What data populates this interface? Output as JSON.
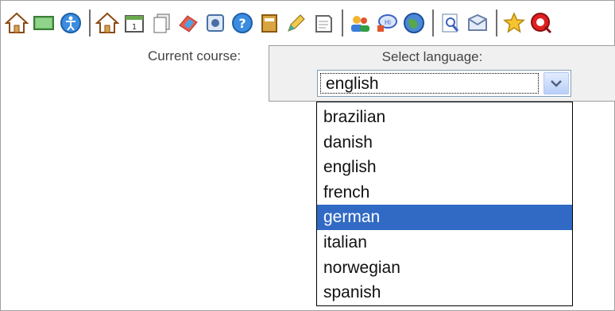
{
  "toolbar": {
    "groups": [
      [
        "home-icon",
        "blackboard-icon",
        "accessibility-icon"
      ],
      [
        "course-home-icon",
        "calendar-icon",
        "documents-icon",
        "lesson-icon",
        "resource-icon",
        "help-icon",
        "binder-icon",
        "edit-icon",
        "notes-icon"
      ],
      [
        "users-icon",
        "chat-icon",
        "web-icon"
      ],
      [
        "search-icon",
        "mail-icon"
      ],
      [
        "star-icon",
        "logout-icon"
      ]
    ]
  },
  "course": {
    "label": "Current course:"
  },
  "language": {
    "title": "Select language:",
    "selected": "english",
    "options": [
      "brazilian",
      "danish",
      "english",
      "french",
      "german",
      "italian",
      "norwegian",
      "spanish"
    ],
    "highlighted": "german"
  },
  "colors": {
    "highlight": "#316ac5",
    "panel": "#f0f0f0"
  }
}
